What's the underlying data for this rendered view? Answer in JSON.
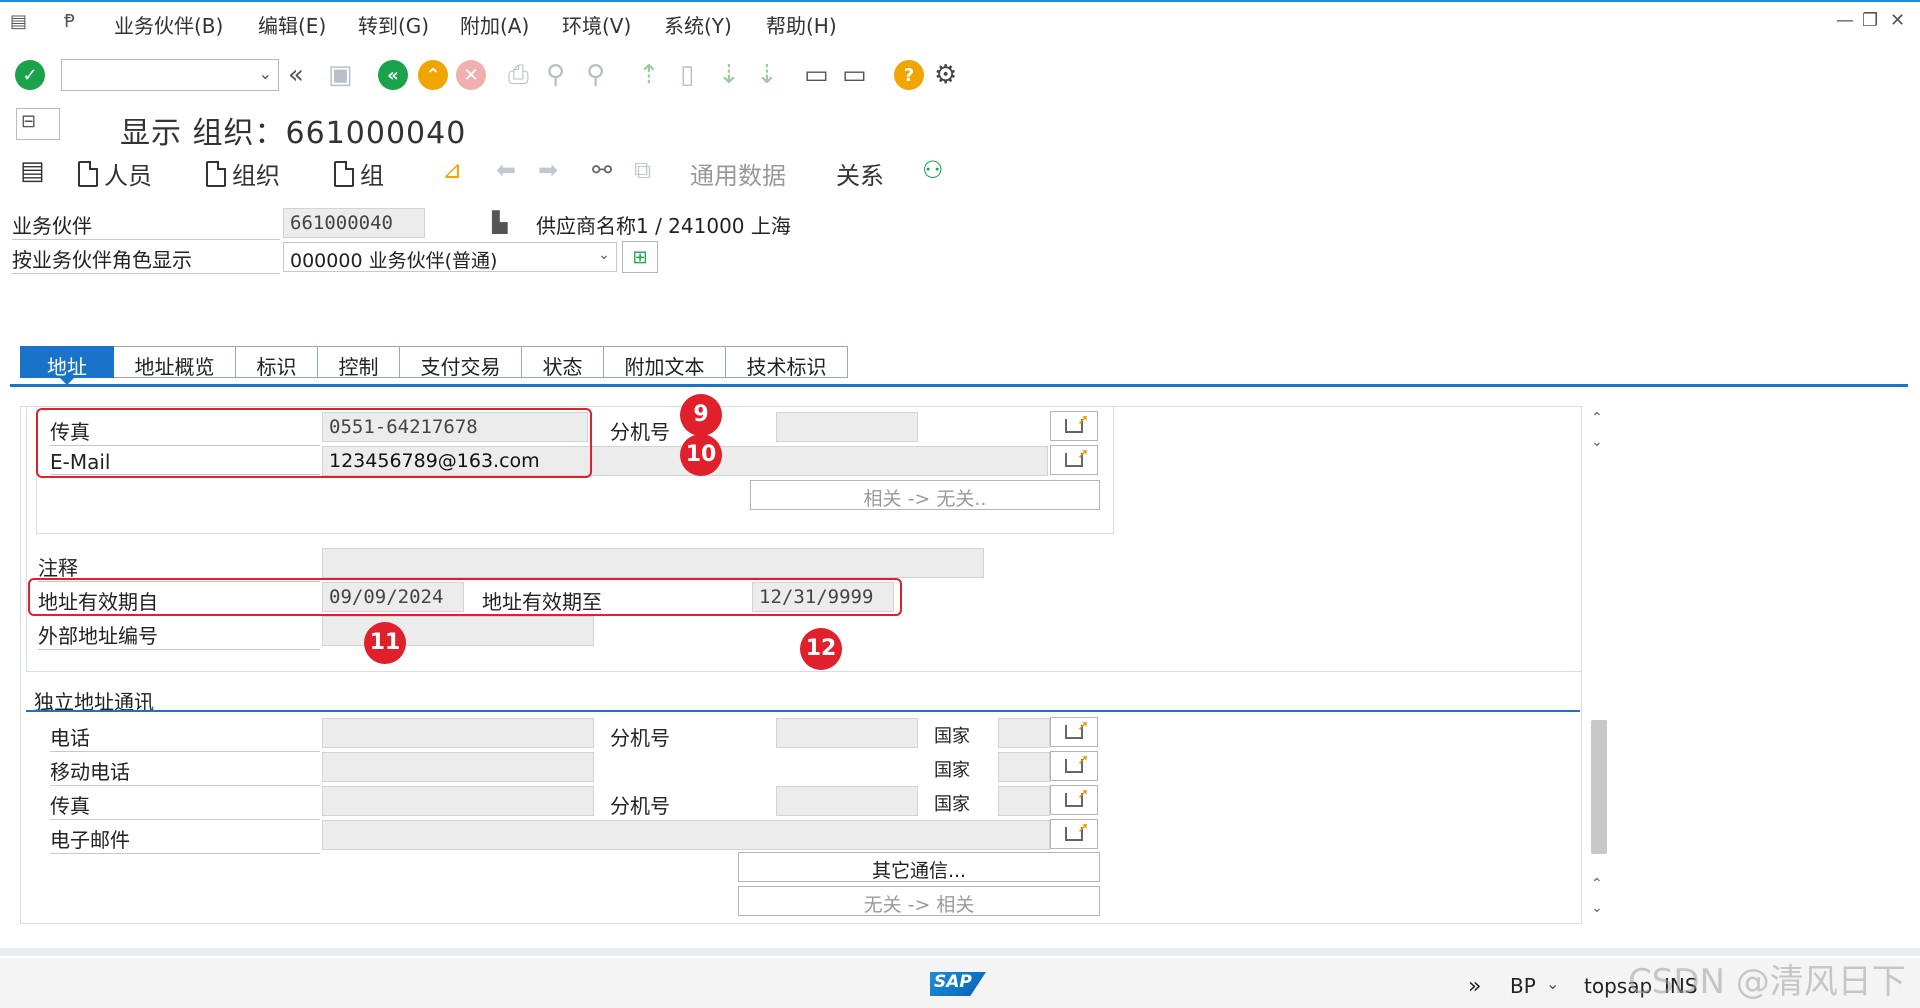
{
  "menu": {
    "items": [
      "业务伙伴(B)",
      "编辑(E)",
      "转到(G)",
      "附加(A)",
      "环境(V)",
      "系统(Y)",
      "帮助(H)"
    ]
  },
  "toolbar": {
    "command_value": ""
  },
  "title": "显示 组织：661000040",
  "app_toolbar": {
    "person": "人员",
    "organization": "组织",
    "group": "组",
    "general_data": "通用数据",
    "relations": "关系"
  },
  "header": {
    "bp_label": "业务伙伴",
    "bp_value": "661000040",
    "bp_desc": "供应商名称1 / 241000 上海",
    "role_label": "按业务伙伴角色显示",
    "role_value": "000000 业务伙伴(普通)"
  },
  "tabs": [
    "地址",
    "地址概览",
    "标识",
    "控制",
    "支付交易",
    "状态",
    "附加文本",
    "技术标识"
  ],
  "address": {
    "fax_label": "传真",
    "fax_value": "0551-64217678",
    "ext_label": "分机号",
    "ext_value": "",
    "email_label": "E-Mail",
    "email_value": "123456789@163.com",
    "relevant_btn": "相关 -> 无关..",
    "note_label": "注释",
    "valid_from_label": "地址有效期自",
    "valid_from_value": "09/09/2024",
    "valid_to_label": "地址有效期至",
    "valid_to_value": "12/31/9999",
    "ext_addr_label": "外部地址编号"
  },
  "independent": {
    "section_title": "独立地址通讯",
    "phone_label": "电话",
    "ext_label": "分机号",
    "country_label": "国家",
    "mobile_label": "移动电话",
    "fax_label": "传真",
    "email_label": "电子邮件",
    "other_btn": "其它通信...",
    "irrelevant_btn": "无关 -> 相关"
  },
  "annotations": [
    "9",
    "10",
    "11",
    "12"
  ],
  "status": {
    "system": "BP",
    "client": "topsap",
    "mode": "INS"
  },
  "watermark": "CSDN @清风日下",
  "colors": {
    "accent": "#1a73c8",
    "annotation": "#e0202a",
    "ok_green": "#1aa34a",
    "warn_orange": "#f0a500",
    "cancel_red": "#e06a6a"
  }
}
